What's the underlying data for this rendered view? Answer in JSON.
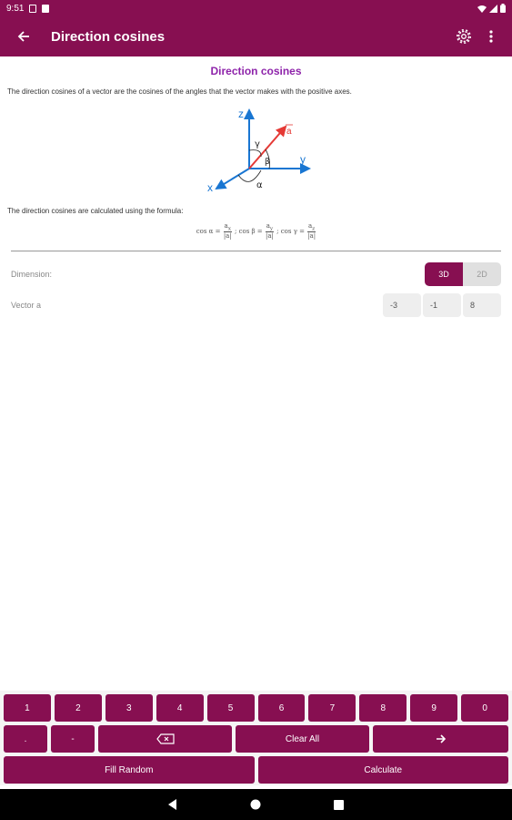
{
  "status_bar": {
    "time": "9:51",
    "icons": [
      "shield-icon",
      "sd-card-icon",
      "wifi-icon",
      "signal-icon",
      "battery-icon"
    ]
  },
  "app_bar": {
    "title": "Direction cosines",
    "icons": [
      "back-arrow-icon",
      "settings-gear-icon",
      "more-vertical-icon"
    ]
  },
  "info": {
    "heading": "Direction cosines",
    "description": "The direction cosines of a vector are the cosines of the angles that the vector makes with the positive axes.",
    "diagram": {
      "labels": {
        "z": "z",
        "y": "y",
        "x": "x",
        "vector": "a",
        "alpha": "α",
        "beta": "β",
        "gamma": "γ"
      }
    },
    "formula_intro": "The direction cosines are calculated using the formula:",
    "formula": {
      "t1": "cos α =",
      "n1": "a",
      "s1": "x",
      "d1": "|a|",
      "t2": "; cos β =",
      "n2": "a",
      "s2": "y",
      "d2": "|a|",
      "t3": "; cos γ =",
      "n3": "a",
      "s3": "z",
      "d3": "|a|"
    }
  },
  "form": {
    "dimension": {
      "label": "Dimension:",
      "options": [
        "3D",
        "2D"
      ],
      "selected": "3D"
    },
    "vector": {
      "label": "Vector a",
      "values": [
        "-3",
        "-1",
        "8"
      ]
    }
  },
  "keyboard": {
    "digits": [
      "1",
      "2",
      "3",
      "4",
      "5",
      "6",
      "7",
      "8",
      "9",
      "0"
    ],
    "dot": ".",
    "minus": "-",
    "backspace_icon": "backspace-icon",
    "clear_all": "Clear All",
    "next_icon": "arrow-right-icon",
    "fill_random": "Fill Random",
    "calculate": "Calculate"
  },
  "nav_bar": {
    "icons": [
      "back-triangle-icon",
      "home-circle-icon",
      "recents-square-icon"
    ]
  },
  "colors": {
    "primary": "#870f51",
    "heading": "#8e24aa",
    "axis_blue": "#1976d2",
    "vector_red": "#e53935"
  }
}
